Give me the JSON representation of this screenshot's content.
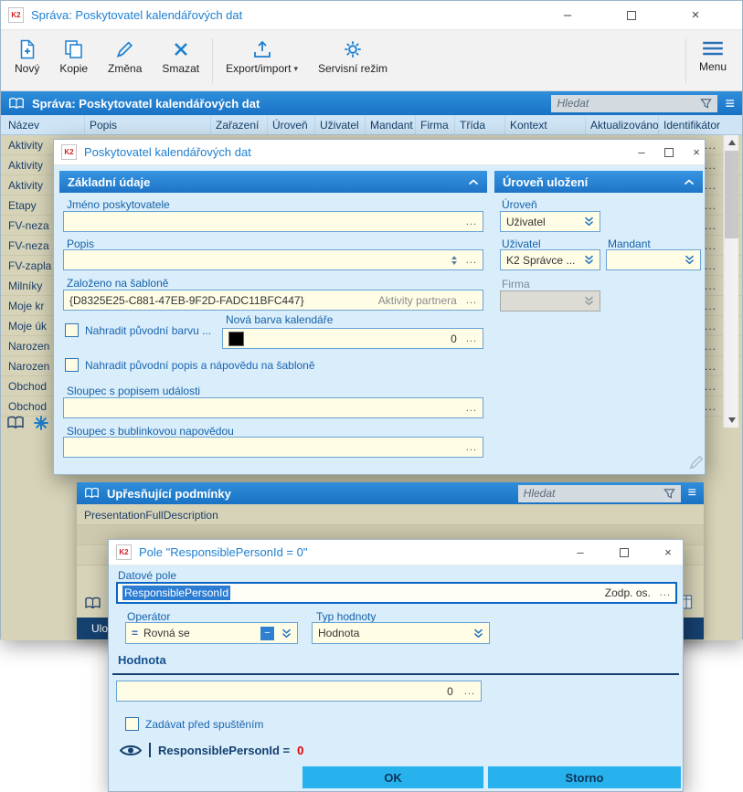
{
  "glyphs": {
    "k2": "K2",
    "ellipsis": "...",
    "caret_down": "▾",
    "hamburger": "≡",
    "minimize": "–",
    "close": "×",
    "equals": "=",
    "minus": "−"
  },
  "main_window": {
    "title": "Správa: Poskytovatel kalendářových dat",
    "toolbar": {
      "buttons": [
        {
          "label": "Nový"
        },
        {
          "label": "Kopie"
        },
        {
          "label": "Změna"
        },
        {
          "label": "Smazat"
        },
        {
          "label": "Export/import"
        },
        {
          "label": "Servisní režim"
        }
      ],
      "menu_label": "Menu"
    },
    "panel_header": {
      "title": "Správa: Poskytovatel kalendářových dat",
      "search_placeholder": "Hledat"
    },
    "table": {
      "columns": [
        "Název",
        "Popis",
        "Zařazení",
        "Úroveň",
        "Uživatel",
        "Mandant",
        "Firma",
        "Třída",
        "Kontext",
        "Aktualizováno",
        "Identifikátor"
      ],
      "rows": [
        "Aktivity",
        "Aktivity",
        "Aktivity",
        "Etapy",
        "FV-neza",
        "FV-neza",
        "FV-zapla",
        "Milníky",
        "Moje kr",
        "Moje úk",
        "Narozen",
        "Narozen",
        "Obchod",
        "Obchod"
      ]
    }
  },
  "provider_dialog": {
    "title": "Poskytovatel kalendářových dat",
    "basic_section": {
      "title": "Základní údaje",
      "jmeno_label": "Jméno poskytovatele",
      "popis_label": "Popis",
      "sablona_label": "Založeno na šabloně",
      "sablona_value": "{D8325E25-C881-47EB-9F2D-FADC11BFC447}",
      "sablona_ref": "Aktivity partnera",
      "nahradit_barvu_label": "Nahradit původní barvu ...",
      "nova_barva_label": "Nová barva kalendáře",
      "nova_barva_value": "0",
      "nahradit_popis_label": "Nahradit původní popis a nápovědu na šabloně",
      "sloupec_popis_label": "Sloupec s popisem události",
      "sloupec_bublina_label": "Sloupec s bublinkovou napovědou"
    },
    "level_section": {
      "title": "Úroveň uložení",
      "uroven_label": "Úroveň",
      "uroven_value": "Uživatel",
      "uzivatel_label": "Uživatel",
      "uzivatel_value": "K2 Správce ...",
      "mandant_label": "Mandant",
      "firma_label": "Firma"
    }
  },
  "conditions_panel": {
    "title": "Upřesňující podmínky",
    "search_placeholder": "Hledat",
    "rows": [
      "PresentationFullDescription"
    ],
    "save_label": "Uložit"
  },
  "field_dialog": {
    "title": "Pole \"ResponsiblePersonId = 0\"",
    "datove_pole_label": "Datové pole",
    "datove_pole_value": "ResponsiblePersonId",
    "datove_pole_ref": "Zodp. os.",
    "operator_label": "Operátor",
    "operator_value": "Rovná se",
    "typ_hodnoty_label": "Typ hodnoty",
    "typ_hodnoty_value": "Hodnota",
    "hodnota_section": "Hodnota",
    "hodnota_value": "0",
    "checkbox_label": "Zadávat před spuštěním",
    "preview_text": "ResponsiblePersonId =",
    "preview_value": "0",
    "ok_label": "OK",
    "storno_label": "Storno"
  }
}
